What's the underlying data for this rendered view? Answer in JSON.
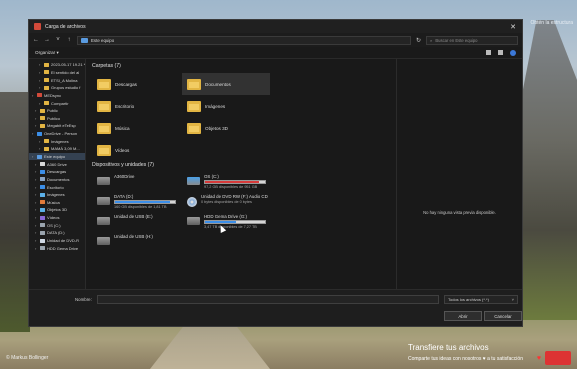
{
  "desktop": {
    "top_right_text": "Obtén la estructura",
    "credit": "© Markus Bollinger",
    "transfer_title": "Transfiere tus archivos",
    "transfer_sub": "Comparte tus ideas con nosotros ♥ a tu satisfacción"
  },
  "dialog": {
    "title": "Carga de archivos",
    "close_label": "✕",
    "address_path": "Este equipo",
    "search_placeholder": "Buscar en Este equipo",
    "organize_label": "Organizar ▾",
    "preview_message": "No hay ninguna vista previa disponible.",
    "filename_label": "Nombre:",
    "filetype_value": "Todos los archivos (*.*)",
    "open_label": "Abrir",
    "cancel_label": "Cancelar"
  },
  "sidebar": {
    "items": [
      {
        "label": "2023-05-17 19.21 *",
        "color": "#e2b543",
        "level": 2
      },
      {
        "label": "El sentido del al",
        "color": "#e2b543",
        "level": 2
      },
      {
        "label": "ETSI_A Molina",
        "color": "#e2b543",
        "level": 2
      },
      {
        "label": "Grupos estudio f",
        "color": "#e2b543",
        "level": 2
      },
      {
        "label": "MEDsync",
        "color": "#d24a3a",
        "level": 0
      },
      {
        "label": "Compartir",
        "color": "#e2b543",
        "level": 2
      },
      {
        "label": "Public",
        "color": "#e2b543",
        "level": 1
      },
      {
        "label": "Publico",
        "color": "#e2b543",
        "level": 1
      },
      {
        "label": "Megabit eTeEsp",
        "color": "#e2b543",
        "level": 1
      },
      {
        "label": "OneDrive - Person",
        "color": "#3b8ee8",
        "level": 0
      },
      {
        "label": "Imágenes",
        "color": "#e2b543",
        "level": 2
      },
      {
        "label": "MAMÁ 3,09 M...",
        "color": "#e2b543",
        "level": 2
      },
      {
        "label": "Este equipo",
        "color": "#5a9be0",
        "level": 0,
        "selected": true
      },
      {
        "label": "A360 Drive",
        "color": "#d8d8d8",
        "level": 1
      },
      {
        "label": "Descargas",
        "color": "#3b8ee8",
        "level": 1
      },
      {
        "label": "Documentos",
        "color": "#8aa4c4",
        "level": 1
      },
      {
        "label": "Escritorio",
        "color": "#3b8ee8",
        "level": 1
      },
      {
        "label": "Imágenes",
        "color": "#5bb0e8",
        "level": 1
      },
      {
        "label": "Música",
        "color": "#e07b3b",
        "level": 1
      },
      {
        "label": "Objetos 3D",
        "color": "#5bb0e8",
        "level": 1
      },
      {
        "label": "Vídeos",
        "color": "#8a6ad8",
        "level": 1
      },
      {
        "label": "OS (C:)",
        "color": "#9aa4ae",
        "level": 1
      },
      {
        "label": "DATA (D:)",
        "color": "#9aa4ae",
        "level": 1
      },
      {
        "label": "Unidad de DVD-R",
        "color": "#cfd8e3",
        "level": 1
      },
      {
        "label": "HDD Gema Drive",
        "color": "#9aa4ae",
        "level": 1
      }
    ]
  },
  "main": {
    "folders_header": "Carpetas (7)",
    "folders": [
      {
        "label": "Descargas"
      },
      {
        "label": "Documentos",
        "selected": true
      },
      {
        "label": "Escritorio"
      },
      {
        "label": "Imágenes"
      },
      {
        "label": "Música"
      },
      {
        "label": "Objetos 3D"
      },
      {
        "label": "Vídeos"
      }
    ],
    "drives_header": "Dispositivos y unidades (7)",
    "drives": [
      {
        "label": "A360Drive",
        "free": "",
        "fill": null,
        "type": "net"
      },
      {
        "label": "OS (C:)",
        "free": "97,2 GB disponibles de 951 GB",
        "fill": 0.9,
        "fill_color": "#d63a3a",
        "type": "win"
      },
      {
        "label": "DATA (D:)",
        "free": "160 GB disponibles de 1,81 TB",
        "fill": 0.91,
        "fill_color": "#3b8ee8",
        "type": "hdd"
      },
      {
        "label": "Unidad de DVD RW (F:) Audio CD",
        "free": "0 bytes disponibles de 0 bytes",
        "fill": null,
        "type": "disc"
      },
      {
        "label": "Unidad de USB (E:)",
        "free": "",
        "fill": null,
        "type": "hdd"
      },
      {
        "label": "HDD Gema Drive (G:)",
        "free": "3,47 TB disponibles de 7,27 TB",
        "fill": 0.52,
        "fill_color": "#3b8ee8",
        "type": "hdd"
      },
      {
        "label": "Unidad de USB (H:)",
        "free": "",
        "fill": null,
        "type": "hdd"
      }
    ]
  }
}
